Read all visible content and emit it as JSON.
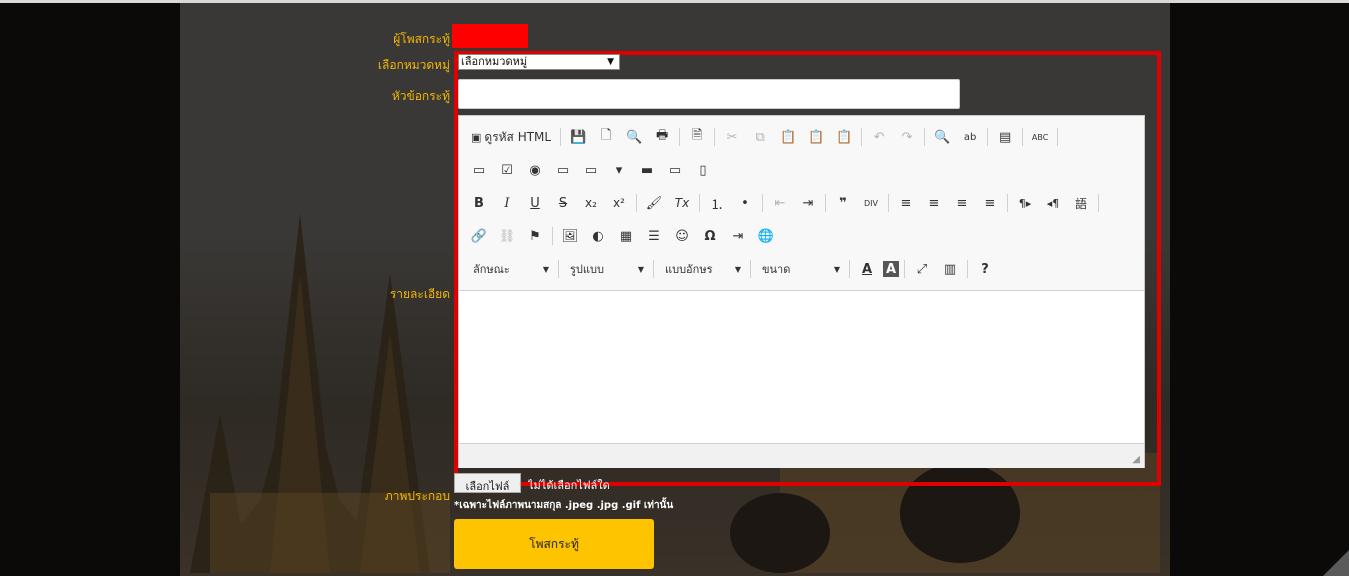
{
  "form": {
    "poster_label": "ผู้โพสกระทู้",
    "category_label": "เลือกหมวดหมู่",
    "category_selected": "เลือกหมวดหมู่",
    "topic_label": "หัวข้อกระทู้",
    "detail_label": "รายละเอียด",
    "image_label": "ภาพประกอบ",
    "file_button": "เลือกไฟล์",
    "file_status": "ไม่ได้เลือกไฟล์ใด",
    "file_note": "*เฉพาะไฟล์ภาพนามสกุล .jpeg .jpg .gif เท่านั้น",
    "submit_label": "โพสกระทู้"
  },
  "editor": {
    "source_label": "ดูรหัส HTML",
    "style_combo": "ลักษณะ",
    "format_combo": "รูปแบบ",
    "font_combo": "แบบอักษร",
    "size_combo": "ขนาด",
    "glyphs": {
      "save": "💾",
      "new": "🗋",
      "preview": "🔍",
      "print": "🖶",
      "templates": "🗎",
      "cut": "✂",
      "copy": "⧉",
      "paste": "📋",
      "paste_text": "📋",
      "paste_word": "📋",
      "undo": "↶",
      "redo": "↷",
      "find": "🔍",
      "replace": "ab",
      "select_all": "▤",
      "spell": "ABC",
      "form": "▭",
      "checkbox": "☑",
      "radio": "◉",
      "textfield": "▭",
      "textarea": "▭",
      "select": "▾",
      "button": "▬",
      "imagebutton": "▭",
      "hidden": "▯",
      "bold": "B",
      "italic": "I",
      "underline": "U",
      "strike": "S",
      "subscript": "x₂",
      "superscript": "x²",
      "copyformat": "🖌",
      "removeformat": "Tx",
      "numlist": "⒈",
      "bulletlist": "•",
      "outdent": "⇤",
      "indent": "⇥",
      "blockquote": "❞",
      "creatediv": "DIV",
      "align_left": "≡",
      "align_center": "≡",
      "align_right": "≡",
      "justify": "≡",
      "ltr": "¶▸",
      "rtl": "◂¶",
      "language": "語",
      "link": "🔗",
      "unlink": "⛓",
      "anchor": "⚑",
      "image": "🖼",
      "flash": "◐",
      "table": "▦",
      "hline": "☰",
      "smiley": "☺",
      "specialchar": "Ω",
      "pagebreak": "⇥",
      "iframe": "🌐",
      "textcolor": "A",
      "bgcolor": "A",
      "maximize": "⤢",
      "showblocks": "▥",
      "about": "?"
    }
  },
  "colors": {
    "label": "#f2b705",
    "highlight_frame": "#e00000",
    "poster_box": "#ff0000",
    "submit": "#ffc400"
  }
}
